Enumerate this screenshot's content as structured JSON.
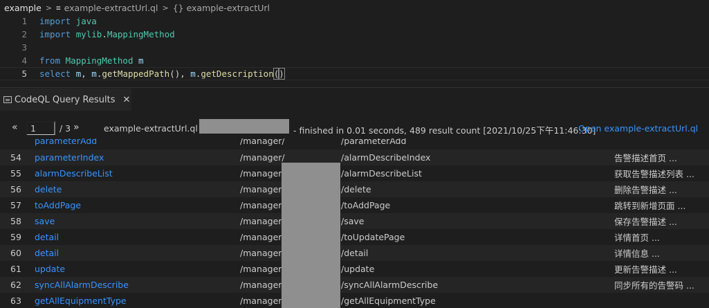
{
  "breadcrumb": {
    "folder": "example",
    "file": "example-extractUrl.ql",
    "symbol": "{} example-extractUrl"
  },
  "editor": {
    "lines": [
      {
        "num": "1",
        "tokens": [
          {
            "t": "import",
            "c": "kw"
          },
          {
            "t": " ",
            "c": "pl"
          },
          {
            "t": "java",
            "c": "ty"
          }
        ]
      },
      {
        "num": "2",
        "tokens": [
          {
            "t": "import",
            "c": "kw"
          },
          {
            "t": " ",
            "c": "pl"
          },
          {
            "t": "mylib",
            "c": "ty"
          },
          {
            "t": ".",
            "c": "pl"
          },
          {
            "t": "MappingMethod",
            "c": "ty"
          }
        ]
      },
      {
        "num": "3",
        "tokens": []
      },
      {
        "num": "4",
        "tokens": [
          {
            "t": "from",
            "c": "kw"
          },
          {
            "t": " ",
            "c": "pl"
          },
          {
            "t": "MappingMethod",
            "c": "ty"
          },
          {
            "t": " ",
            "c": "pl"
          },
          {
            "t": "m",
            "c": "var"
          }
        ]
      },
      {
        "num": "5",
        "tokens": [
          {
            "t": "select",
            "c": "kw"
          },
          {
            "t": " ",
            "c": "pl"
          },
          {
            "t": "m",
            "c": "var"
          },
          {
            "t": ", ",
            "c": "pl"
          },
          {
            "t": "m",
            "c": "var"
          },
          {
            "t": ".",
            "c": "pl"
          },
          {
            "t": "getMappedPath",
            "c": "fn"
          },
          {
            "t": "(), ",
            "c": "pl"
          },
          {
            "t": "m",
            "c": "var"
          },
          {
            "t": ".",
            "c": "pl"
          },
          {
            "t": "getDescription",
            "c": "fn"
          },
          {
            "t": "(",
            "c": "pl bracket"
          },
          {
            "t": ")",
            "c": "pl bracket"
          }
        ]
      }
    ]
  },
  "panel": {
    "tab_label": "CodeQL Query Results",
    "close_glyph": "✕"
  },
  "results": {
    "prev_glyph": "«",
    "next_glyph": "»",
    "page_value": "1",
    "page_total": "/ 3",
    "run_info_prefix": "example-extractUrl.ql on",
    "run_info_suffix": "- finished in 0.01 seconds, 489 result count [2021/10/25下午11:46:30]",
    "open_link": "Open example-extractUrl.ql",
    "partial_row": {
      "name": "parameterAdd",
      "path1": "/manager/",
      "path2": "/parameterAdd"
    },
    "rows": [
      {
        "num": "54",
        "name": "parameterIndex",
        "path1": "/manager/",
        "path2": "/alarmDescribeIndex",
        "desc": "告警描述首页 ..."
      },
      {
        "num": "55",
        "name": "alarmDescribeList",
        "path1": "/manager/",
        "path2": "/alarmDescribeList",
        "desc": "获取告警描述列表 ..."
      },
      {
        "num": "56",
        "name": "delete",
        "path1": "/manager/",
        "path2": "/delete",
        "desc": "删除告警描述 ..."
      },
      {
        "num": "57",
        "name": "toAddPage",
        "path1": "/manager/",
        "path2": "/toAddPage",
        "desc": "跳转到新增页面 ..."
      },
      {
        "num": "58",
        "name": "save",
        "path1": "/manager/",
        "path2": "/save",
        "desc": "保存告警描述 ..."
      },
      {
        "num": "59",
        "name": "detail",
        "path1": "/manager/",
        "path2": "/toUpdatePage",
        "desc": "详情首页 ..."
      },
      {
        "num": "60",
        "name": "detail",
        "path1": "/manager/",
        "path2": "/detail",
        "desc": "详情信息 ..."
      },
      {
        "num": "61",
        "name": "update",
        "path1": "/manager/",
        "path2": "/update",
        "desc": "更新告警描述 ..."
      },
      {
        "num": "62",
        "name": "syncAllAlarmDescribe",
        "path1": "/manager/",
        "path2": "/syncAllAlarmDescribe",
        "desc": "同步所有的告警码 ..."
      },
      {
        "num": "63",
        "name": "getAllEquipmentType",
        "path1": "/manager/",
        "path2": "/getAllEquipmentType",
        "desc": ""
      }
    ]
  },
  "colors": {
    "background": "#1e1e1e",
    "link": "#3794ff",
    "keyword": "#569cd6",
    "type": "#4ec9b0",
    "function": "#dcdcaa",
    "variable": "#9cdcfe",
    "redaction": "#8f8f8f"
  }
}
